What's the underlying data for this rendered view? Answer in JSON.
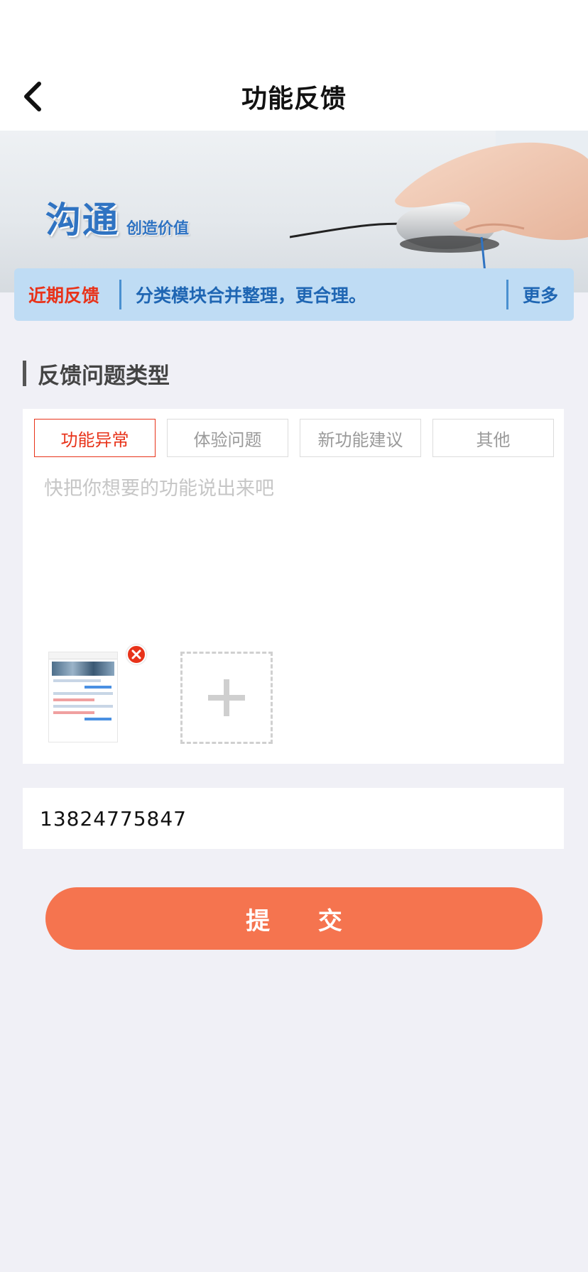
{
  "header": {
    "title": "功能反馈",
    "back_icon": "chevron-left-icon"
  },
  "banner": {
    "logo_main": "沟通",
    "logo_sub": "创造价值"
  },
  "recent": {
    "label": "近期反馈",
    "text": "分类模块合并整理，更合理。",
    "more": "更多"
  },
  "section": {
    "title": "反馈问题类型"
  },
  "tabs": [
    {
      "label": "功能异常",
      "active": true
    },
    {
      "label": "体验问题",
      "active": false
    },
    {
      "label": "新功能建议",
      "active": false
    },
    {
      "label": "其他",
      "active": false
    }
  ],
  "feedback": {
    "placeholder": "快把你想要的功能说出来吧",
    "value": ""
  },
  "attachments": {
    "remove_icon": "close-circle-icon",
    "add_icon": "plus-icon"
  },
  "phone": {
    "value": "13824775847"
  },
  "submit": {
    "label": "提 交"
  },
  "colors": {
    "accent_red": "#e8331a",
    "submit_orange": "#f5744f",
    "recent_bar_bg": "#bfdcf4",
    "link_blue": "#1f66b3",
    "page_bg": "#f0f0f6"
  }
}
